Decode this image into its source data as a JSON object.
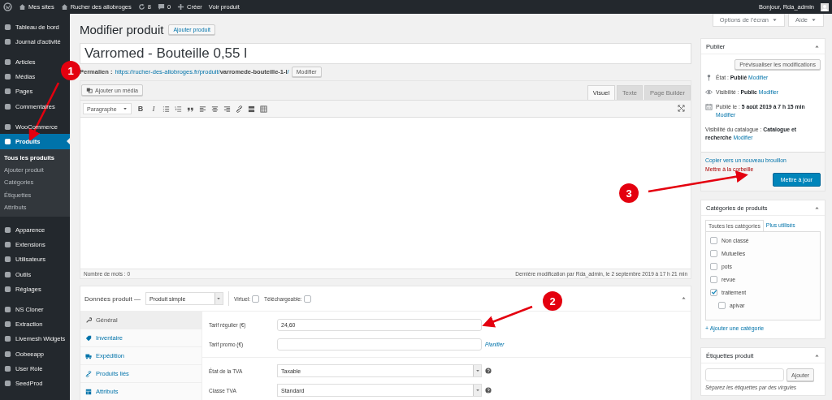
{
  "admin_bar": {
    "items": [
      {
        "kind": "logo"
      },
      {
        "kind": "sites",
        "label": "Mes sites"
      },
      {
        "kind": "home",
        "label": "Rucher des allobroges"
      },
      {
        "kind": "updates",
        "label": "8"
      },
      {
        "kind": "comments",
        "label": "0"
      },
      {
        "kind": "new",
        "label": "Créer"
      },
      {
        "kind": "text",
        "label": "Voir produit"
      }
    ],
    "greeting": "Bonjour, Rda_admin"
  },
  "sidebar": {
    "groups": [
      [
        {
          "label": "Tableau de bord",
          "selected": false
        },
        {
          "label": "Journal d'activité",
          "selected": false
        }
      ],
      [
        {
          "label": "Articles",
          "selected": false
        },
        {
          "label": "Médias",
          "selected": false
        },
        {
          "label": "Pages",
          "selected": false
        },
        {
          "label": "Commentaires",
          "selected": false
        }
      ],
      [
        {
          "label": "WooCommerce",
          "selected": false
        },
        {
          "label": "Produits",
          "selected": true,
          "children": [
            {
              "label": "Tous les produits",
              "selected": true
            },
            {
              "label": "Ajouter produit",
              "selected": false
            },
            {
              "label": "Catégories",
              "selected": false
            },
            {
              "label": "Étiquettes",
              "selected": false
            },
            {
              "label": "Attributs",
              "selected": false
            }
          ]
        }
      ],
      [
        {
          "label": "Apparence",
          "selected": false
        },
        {
          "label": "Extensions",
          "selected": false
        },
        {
          "label": "Utilisateurs",
          "selected": false
        },
        {
          "label": "Outils",
          "selected": false
        },
        {
          "label": "Réglages",
          "selected": false
        }
      ],
      [
        {
          "label": "NS Cloner",
          "selected": false
        },
        {
          "label": "Extraction",
          "selected": false
        },
        {
          "label": "Livemesh Widgets",
          "selected": false
        },
        {
          "label": "Oobeeapp",
          "selected": false
        },
        {
          "label": "User Role",
          "selected": false
        },
        {
          "label": "SeedProd",
          "selected": false
        }
      ]
    ]
  },
  "screen_options": [
    "Options de l'écran",
    "Aide"
  ],
  "header": {
    "title": "Modifier produit",
    "add_button": "Ajouter produit"
  },
  "product_title": "Varromed - Bouteille 0,55 l",
  "permalink": {
    "label": "Permalien :",
    "url": "https://rucher-des-allobroges.fr/produit/**varromede-bouteille-1-l**/",
    "button": "Modifier"
  },
  "editor": {
    "media_button": "Ajouter un média",
    "tabs": [
      {
        "label": "Visuel",
        "selected": true
      },
      {
        "label": "Texte",
        "selected": false
      },
      {
        "label": "Page Builder",
        "selected": false
      }
    ],
    "format": "Paragraphe",
    "toolbar_glyphs": [
      "B",
      "I"
    ],
    "word_count": "Nombre de mots : 0",
    "last_modified": "Dernière modification par Rda_admin, le 2 septembre 2019 à 17 h 21 min"
  },
  "product_data": {
    "label": "Données produit —",
    "type": "Produit simple",
    "options": [
      {
        "label": "Virtuel:",
        "checked": false
      },
      {
        "label": "Téléchargeable:",
        "checked": false
      }
    ],
    "tabs": [
      {
        "label": "Général",
        "selected": true
      },
      {
        "label": "Inventaire",
        "selected": false
      },
      {
        "label": "Expédition",
        "selected": false
      },
      {
        "label": "Produits liés",
        "selected": false
      },
      {
        "label": "Attributs",
        "selected": false
      }
    ],
    "field_groups": [
      [
        {
          "kind": "text",
          "label": "Tarif régulier (€)",
          "value": "24,60"
        },
        {
          "kind": "text",
          "label": "Tarif promo (€)",
          "link": "Planifier"
        }
      ],
      [
        {
          "kind": "select",
          "label": "État de la TVA",
          "value": "Taxable"
        },
        {
          "kind": "select",
          "label": "Classe TVA",
          "value": "Standard"
        }
      ]
    ]
  },
  "publish": {
    "title": "Publier",
    "preview_button": "Prévisualiser les modifications",
    "rows": [
      {
        "kind": "status",
        "text": "État : **Publié**",
        "link": "Modifier"
      },
      {
        "kind": "visibility",
        "text": "Visibilité : **Public**",
        "link": "Modifier"
      },
      {
        "kind": "date",
        "text": "Publié le : **5 août 2019 à 7 h 15 min**",
        "link": "Modifier"
      },
      {
        "kind": "catalog",
        "text": "Visibilité du catalogue : **Catalogue et recherche**",
        "link": "Modifier"
      }
    ],
    "copy_link": "Copier vers un nouveau brouillon",
    "trash_link": "Mettre à la corbeille",
    "update_button": "Mettre à jour"
  },
  "categories": {
    "title": "Catégories de produits",
    "tabs": [
      {
        "label": "Toutes les catégories",
        "selected": true
      },
      {
        "label": "Plus utilisés",
        "selected": false
      }
    ],
    "items": [
      {
        "label": "Non classé",
        "checked": false
      },
      {
        "label": "Mutuelles",
        "checked": false
      },
      {
        "label": "pots",
        "checked": false
      },
      {
        "label": "revue",
        "checked": false
      },
      {
        "label": "traitement",
        "checked": true,
        "children": [
          {
            "label": "apivar",
            "checked": false
          }
        ]
      }
    ],
    "add_link": "+ Ajouter une catégorie"
  },
  "tags": {
    "title": "Étiquettes produit",
    "button": "Ajouter",
    "hint": "Séparez les étiquettes par des virgules"
  },
  "annotations": [
    {
      "label": "1"
    },
    {
      "label": "2"
    },
    {
      "label": "3"
    }
  ]
}
